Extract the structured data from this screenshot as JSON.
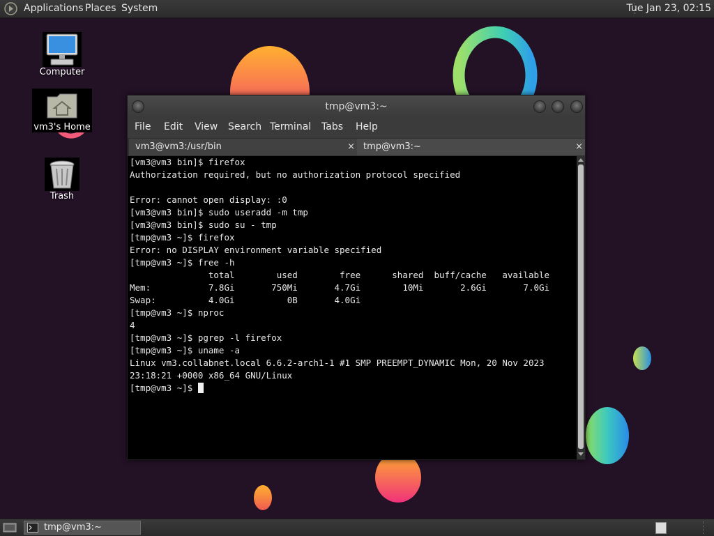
{
  "top_panel": {
    "menus": [
      "Applications",
      "Places",
      "System"
    ],
    "clock": "Tue Jan 23, 02:15"
  },
  "desktop": {
    "icons": [
      {
        "label": "Computer",
        "icon": "computer-icon"
      },
      {
        "label": "vm3's Home",
        "icon": "home-folder-icon"
      },
      {
        "label": "Trash",
        "icon": "trash-icon"
      }
    ]
  },
  "window": {
    "title": "tmp@vm3:~",
    "menu": [
      "File",
      "Edit",
      "View",
      "Search",
      "Terminal",
      "Tabs",
      "Help"
    ],
    "tabs": [
      {
        "label": "vm3@vm3:/usr/bin",
        "close": "×"
      },
      {
        "label": "tmp@vm3:~",
        "close": "×"
      }
    ],
    "terminal_lines": [
      "[vm3@vm3 bin]$ firefox",
      "Authorization required, but no authorization protocol specified",
      "",
      "Error: cannot open display: :0",
      "[vm3@vm3 bin]$ sudo useradd -m tmp",
      "[vm3@vm3 bin]$ sudo su - tmp",
      "[tmp@vm3 ~]$ firefox",
      "Error: no DISPLAY environment variable specified",
      "[tmp@vm3 ~]$ free -h",
      "               total        used        free      shared  buff/cache   available",
      "Mem:           7.8Gi       750Mi       4.7Gi        10Mi       2.6Gi       7.0Gi",
      "Swap:          4.0Gi          0B       4.0Gi",
      "[tmp@vm3 ~]$ nproc",
      "4",
      "[tmp@vm3 ~]$ pgrep -l firefox",
      "[tmp@vm3 ~]$ uname -a",
      "Linux vm3.collabnet.local 6.6.2-arch1-1 #1 SMP PREEMPT_DYNAMIC Mon, 20 Nov 2023",
      "23:18:21 +0000 x86_64 GNU/Linux"
    ],
    "prompt": "[tmp@vm3 ~]$ "
  },
  "bottom_panel": {
    "task_label": "tmp@vm3:~"
  }
}
